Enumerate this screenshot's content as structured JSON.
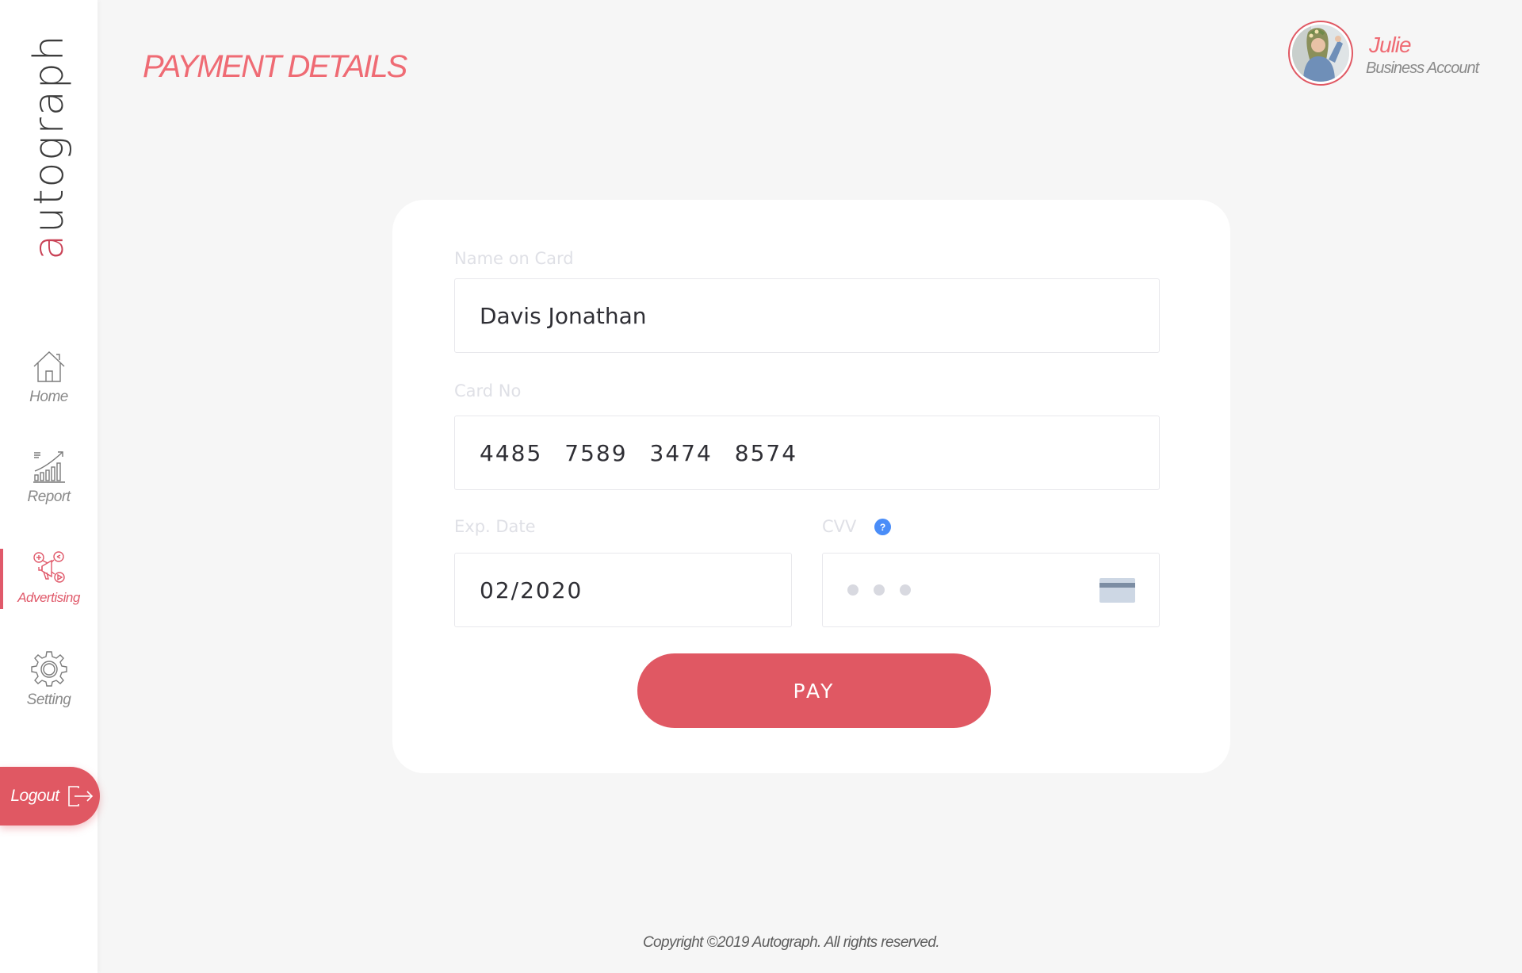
{
  "app": {
    "logo_text": "autograph"
  },
  "sidebar": {
    "items": [
      {
        "label": "Home",
        "icon": "home-icon",
        "active": false
      },
      {
        "label": "Report",
        "icon": "report-chart-icon",
        "active": false
      },
      {
        "label": "Advertising",
        "icon": "advertising-megaphone-icon",
        "active": true
      },
      {
        "label": "Setting",
        "icon": "gear-icon",
        "active": false
      }
    ],
    "logout_label": "Logout"
  },
  "header": {
    "page_title": "PAYMENT DETAILS"
  },
  "user": {
    "name": "Julie",
    "account_type": "Business Account"
  },
  "form": {
    "name_label": "Name on Card",
    "name_value": "Davis Jonathan",
    "card_label": "Card No",
    "card_groups": [
      "4485",
      "7589",
      "3474",
      "8574"
    ],
    "exp_label": "Exp. Date",
    "exp_value": "02/2020",
    "cvv_label": "CVV",
    "cvv_help": "?",
    "pay_label": "PAY"
  },
  "footer": {
    "copyright": "Copyright ©2019 Autograph. All rights reserved."
  },
  "colors": {
    "accent": "#e05863",
    "title": "#ef6b74",
    "background": "#f6f6f6",
    "help_blue": "#4a8df8"
  }
}
